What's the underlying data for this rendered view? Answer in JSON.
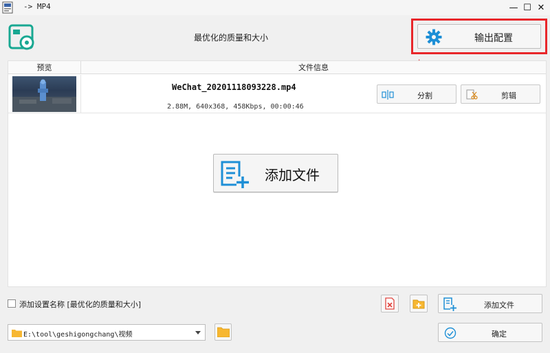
{
  "window": {
    "title": "-> MP4",
    "controls": {
      "minimize": "—",
      "maximize": "☐",
      "close": "✕"
    }
  },
  "header": {
    "title": "最优化的质量和大小",
    "output_config_label": "输出配置",
    "accent_color": "#1e8fd6",
    "highlight_color": "#e8262a"
  },
  "file_list": {
    "columns": {
      "preview": "预览",
      "info": "文件信息"
    },
    "files": [
      {
        "name": "WeChat_20201118093228.mp4",
        "meta": "2.88M, 640x368, 458Kbps, 00:00:46",
        "split_label": "分割",
        "clip_label": "剪辑"
      }
    ],
    "add_file_label": "添加文件"
  },
  "footer": {
    "save_name_label": "添加设置名称 [最优化的质量和大小]",
    "save_name_checked": false,
    "add_file_label": "添加文件",
    "output_path": "E:\\tool\\geshigongchang\\视频",
    "ok_label": "确定"
  },
  "icons": {
    "app": "app-doc-icon",
    "logo": "converter-logo-icon",
    "gear": "gear-icon",
    "split": "split-icon",
    "clip": "scissors-icon",
    "add_file": "file-add-icon",
    "remove": "remove-file-icon",
    "add_folder": "add-folder-icon",
    "folder": "folder-icon",
    "ok": "check-circle-icon"
  }
}
